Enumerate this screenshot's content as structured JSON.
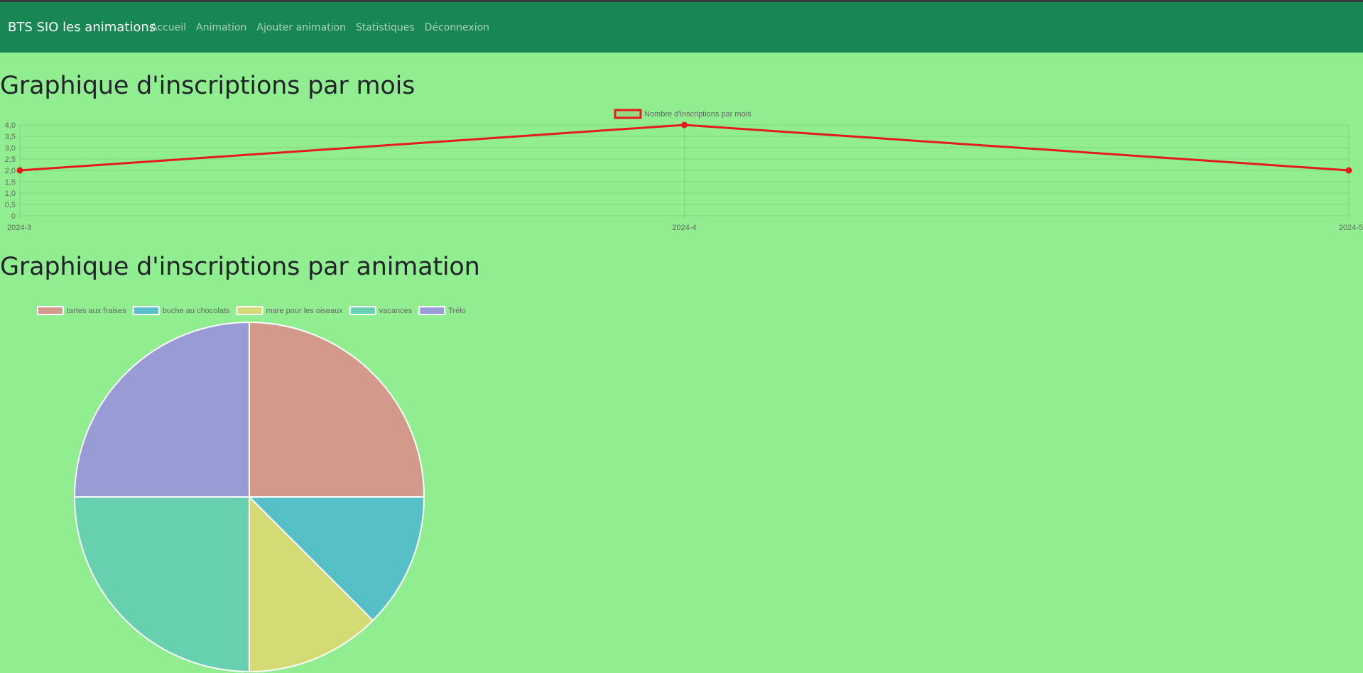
{
  "navbar": {
    "brand": "BTS SIO les animations",
    "links": [
      "Accueil",
      "Animation",
      "Ajouter animation",
      "Statistiques",
      "Déconnexion"
    ]
  },
  "sections": {
    "month_title": "Graphique d'inscriptions par mois",
    "animation_title": "Graphique d'inscriptions par animation"
  },
  "colors": {
    "page_background": "#90ee90",
    "navbar": "#198754",
    "line": "#e41a1c",
    "pie": [
      "#d3998a",
      "#57bfc8",
      "#d4db74",
      "#67d0ae",
      "#989bd4"
    ]
  },
  "chart_data": [
    {
      "type": "line",
      "title": "",
      "legend": [
        "Nombre d'inscriptions par mois"
      ],
      "legend_position": "top",
      "x": [
        "2024-3",
        "2024-4",
        "2024-5"
      ],
      "series": [
        {
          "name": "Nombre d'inscriptions par mois",
          "values": [
            2,
            4,
            2
          ]
        }
      ],
      "ylim": [
        0,
        4
      ],
      "y_ticks": [
        "0",
        "0,5",
        "1,0",
        "1,5",
        "2,0",
        "2,5",
        "3,0",
        "3,5",
        "4,0"
      ],
      "grid": true
    },
    {
      "type": "pie",
      "title": "",
      "legend_position": "top-left",
      "categories": [
        "tartes aux fraises",
        "buche au chocolats",
        "mare pour les oiseaux",
        "vacances",
        "Trélo"
      ],
      "values": [
        2,
        1,
        1,
        2,
        2
      ]
    }
  ]
}
